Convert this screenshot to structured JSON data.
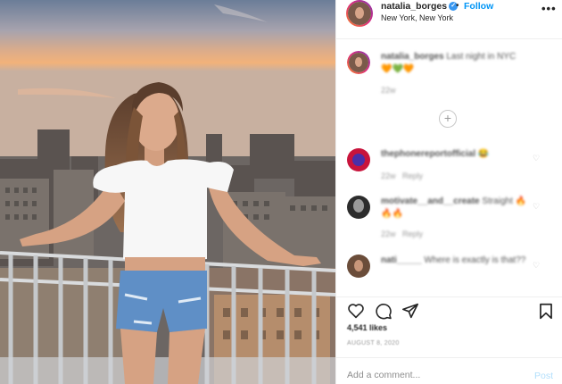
{
  "header": {
    "username": "natalia_borges",
    "verified_mark": "✓",
    "separator": "•",
    "follow_label": "Follow",
    "location": "New York, New York",
    "more_icon": "more-options-icon"
  },
  "caption": {
    "username": "natalia_borges",
    "text": "Last night in NYC",
    "emojis": "🧡💚🧡",
    "time": "22w"
  },
  "load_more_icon": "plus-circle-icon",
  "comments": [
    {
      "username": "thephonereportofficial",
      "text": "😂",
      "time": "22w",
      "reply_label": "Reply"
    },
    {
      "username": "motivate__and__create",
      "text": "Straight 🔥🔥🔥",
      "time": "22w",
      "reply_label": "Reply"
    },
    {
      "username": "nati_____",
      "text": "Where is exactly is that??",
      "time": "",
      "reply_label": ""
    }
  ],
  "actions": {
    "like_icon": "heart-icon",
    "comment_icon": "comment-icon",
    "share_icon": "share-icon",
    "save_icon": "bookmark-icon"
  },
  "likes": "4,541 likes",
  "date": "AUGUST 8, 2020",
  "add_comment": {
    "placeholder": "Add a comment...",
    "post_label": "Post"
  },
  "colors": {
    "link_blue": "#0095f6",
    "verified_blue": "#3897f0",
    "post_disabled": "#b2dffc"
  }
}
